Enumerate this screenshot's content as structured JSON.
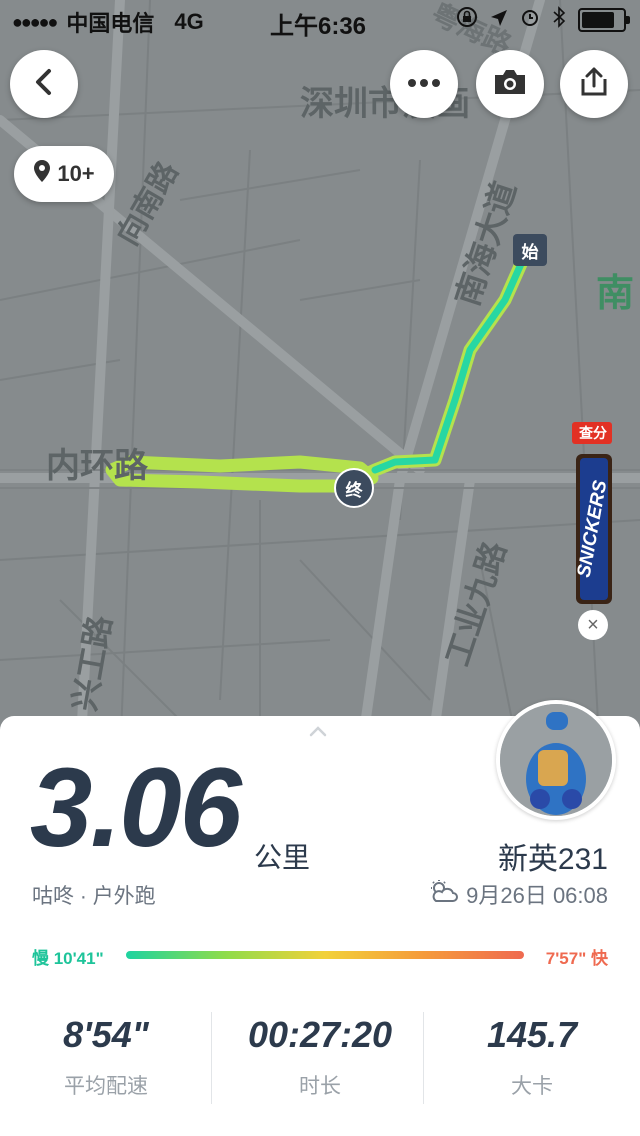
{
  "status_bar": {
    "signal": "●●●●●",
    "carrier": "中国电信",
    "network": "4G",
    "time": "上午6:36",
    "battery_level": 0.9
  },
  "map": {
    "labels": {
      "district": "深圳市漫画",
      "road_vertical_left": "向南路",
      "road_horizontal": "内环路",
      "road_nanhai": "南海大道",
      "road_industrial": "工业九路",
      "road_xinggong": "兴工路",
      "east_char": "南",
      "top_street": "粤海路"
    },
    "photo_count": "10+",
    "start_marker": "始",
    "end_marker": "终",
    "ad": {
      "tag": "查分",
      "brand": "SNICKERS",
      "close_label": "×"
    },
    "icons": {
      "back": "back-icon",
      "more": "more-icon",
      "camera": "camera-icon",
      "share": "share-icon",
      "location": "location-pin-icon"
    }
  },
  "summary": {
    "distance": "3.06",
    "unit": "公里",
    "username": "新英231",
    "subtitle": "咕咚 · 户外跑",
    "datetime": "9月26日 06:08",
    "weather_icon": "partly-cloudy-icon",
    "pace_slow_label": "慢 10'41\"",
    "pace_fast_label": "7'57\" 快",
    "stats": [
      {
        "value": "8'54\"",
        "label": "平均配速"
      },
      {
        "value": "00:27:20",
        "label": "时长"
      },
      {
        "value": "145.7",
        "label": "大卡"
      }
    ],
    "colors": {
      "accent_teal": "#1ec49a",
      "accent_red": "#ef6a50",
      "text_dark": "#2c3a4c"
    }
  }
}
